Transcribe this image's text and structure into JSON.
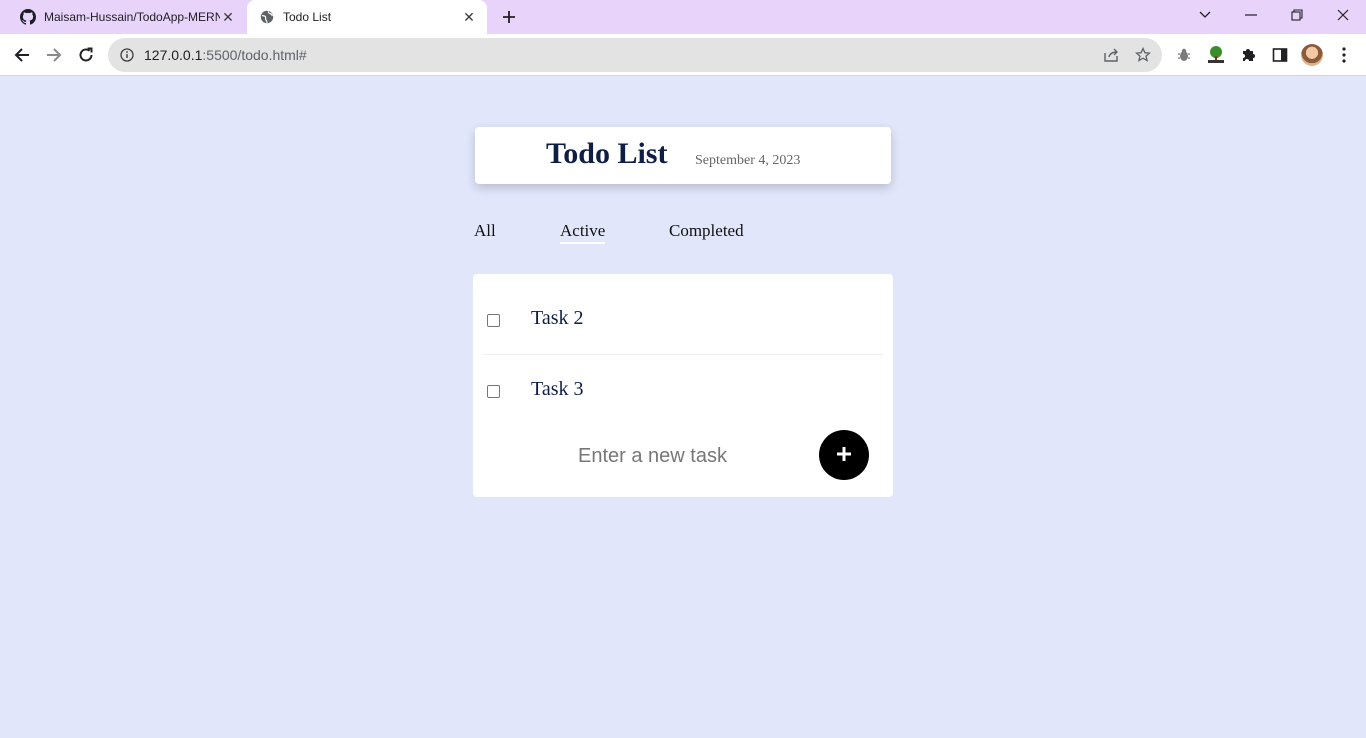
{
  "browser": {
    "tabs": [
      {
        "title": "Maisam-Hussain/TodoApp-MERN",
        "icon": "github-icon",
        "active": false
      },
      {
        "title": "Todo List",
        "icon": "globe-icon",
        "active": true
      }
    ],
    "url": {
      "host": "127.0.0.1",
      "rest": ":5500/todo.html#"
    }
  },
  "header": {
    "title": "Todo List",
    "date": "September 4, 2023"
  },
  "filters": {
    "all": "All",
    "active": "Active",
    "completed": "Completed",
    "selected": "Active"
  },
  "tasks": [
    {
      "label": "Task 2",
      "done": false
    },
    {
      "label": "Task 3",
      "done": false
    }
  ],
  "new_task": {
    "placeholder": "Enter a new task"
  },
  "colors": {
    "page_background": "#e2e6fb",
    "tabstrip": "#e8d3fb",
    "title_color": "#0f1e44",
    "add_button": "#000000"
  }
}
